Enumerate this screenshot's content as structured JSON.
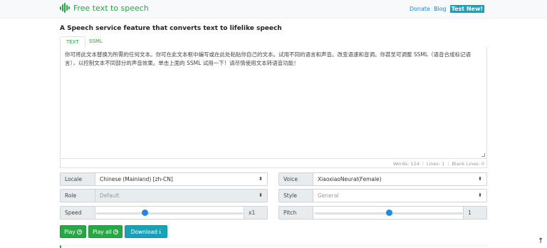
{
  "navbar": {
    "brand": "Free text to speech",
    "links": {
      "donate": "Donate",
      "blog": "Blog",
      "test": "Test New!"
    }
  },
  "page_title": "A Speech service feature that converts text to lifelike speech",
  "tabs": {
    "text": "TEXT",
    "ssml": "SSML"
  },
  "editor": {
    "content": "你可将此文本替换为所需的任何文本。你可在此文本框中编写或在此处粘贴你自己的文本。试用不同的语言和声音。改变语速和音调。你甚至可调整 SSML（语音合成标记语言），以控制文本不同部分的声音效果。单击上面的 SSML 试用一下！请尽情使用文本转语音功能！"
  },
  "stats": {
    "words": "Words: 124",
    "lines": "Lines: 1",
    "blank_lines": "Blank Lines: 0"
  },
  "controls": {
    "locale": {
      "label": "Locale",
      "value": "Chinese (Mainland) [zh-CN]"
    },
    "voice": {
      "label": "Voice",
      "value": "XiaoxiaoNeural(Female)"
    },
    "role": {
      "label": "Role",
      "value": "Default"
    },
    "style": {
      "label": "Style",
      "value": "General"
    },
    "speed": {
      "label": "Speed",
      "value": "x1",
      "position": 0.33
    },
    "pitch": {
      "label": "Pitch",
      "value": "1",
      "position": 0.5
    }
  },
  "buttons": {
    "play": "Play",
    "play_all": "Play all",
    "download": "Download"
  },
  "scroll_top": "↑",
  "colors": {
    "brand": "#28a745",
    "link": "#1e88e5",
    "badge": "#17a2b8",
    "slider": "#1e88e5"
  }
}
